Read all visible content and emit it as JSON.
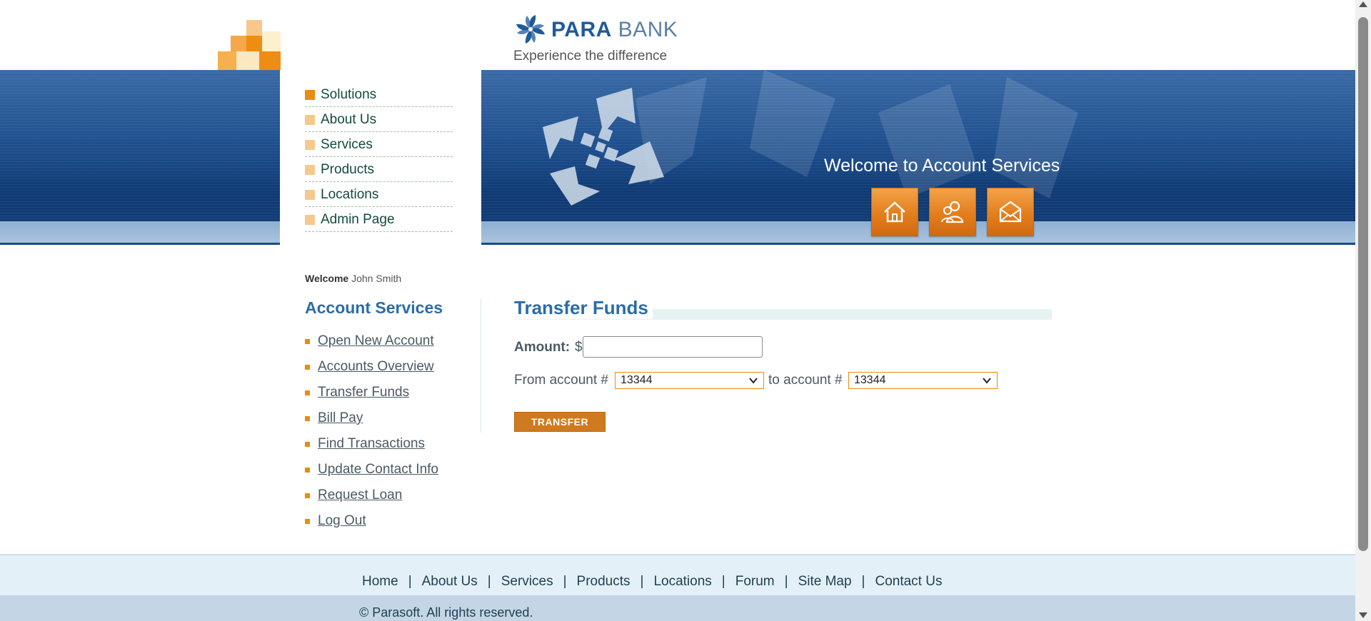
{
  "brand": {
    "name_bold": "PARA",
    "name_light": "BANK",
    "caption": "Experience the difference"
  },
  "left_menu": [
    {
      "label": "Solutions"
    },
    {
      "label": "About Us"
    },
    {
      "label": "Services"
    },
    {
      "label": "Products"
    },
    {
      "label": "Locations"
    },
    {
      "label": "Admin Page"
    }
  ],
  "banner": {
    "title": "Welcome to Account Services",
    "icons": [
      "home-icon",
      "about-people-icon",
      "contact-envelope-icon"
    ]
  },
  "user": {
    "welcome_label": "Welcome",
    "name": "John Smith"
  },
  "account_services": {
    "heading": "Account Services",
    "items": [
      {
        "label": "Open New Account"
      },
      {
        "label": "Accounts Overview"
      },
      {
        "label": "Transfer Funds"
      },
      {
        "label": "Bill Pay"
      },
      {
        "label": "Find Transactions"
      },
      {
        "label": "Update Contact Info"
      },
      {
        "label": "Request Loan"
      },
      {
        "label": "Log Out"
      }
    ]
  },
  "transfer": {
    "title": "Transfer Funds",
    "amount_label": "Amount:",
    "currency_symbol": "$",
    "amount_value": "",
    "from_label": "From account #",
    "from_value": "13344",
    "to_label": "to account #",
    "to_value": "13344",
    "button_label": "TRANSFER"
  },
  "footer": {
    "links": [
      {
        "label": "Home"
      },
      {
        "label": "About Us"
      },
      {
        "label": "Services"
      },
      {
        "label": "Products"
      },
      {
        "label": "Locations"
      },
      {
        "label": "Forum"
      },
      {
        "label": "Site Map"
      },
      {
        "label": "Contact Us"
      }
    ],
    "separator": "|",
    "copyright": "© Parasoft. All rights reserved."
  },
  "colors": {
    "accent_orange": "#e98c10",
    "heading_blue": "#2b6ca8",
    "banner_blue": "#1d4e8c"
  }
}
